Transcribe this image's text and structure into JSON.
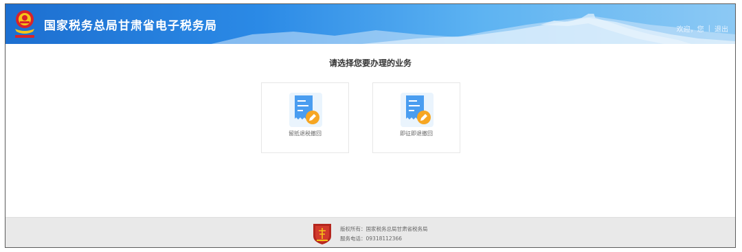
{
  "header": {
    "title": "国家税务总局甘肃省电子税务局",
    "welcome": "欢迎，您",
    "separator": "|",
    "logout": "退出"
  },
  "main": {
    "title": "请选择您要办理的业务",
    "cards": [
      {
        "label": "留抵退税撤回",
        "icon": "document-edit-icon"
      },
      {
        "label": "即征即退撤回",
        "icon": "document-edit-icon"
      }
    ]
  },
  "footer": {
    "copyright": "版权所有：国家税务总局甘肃省税务局",
    "phone": "服务电话：09318112366"
  },
  "colors": {
    "header_blue": "#1d6fd0",
    "icon_blue": "#4a9df0",
    "pencil_orange": "#f6a623",
    "footer_gray": "#e9e9e9"
  }
}
